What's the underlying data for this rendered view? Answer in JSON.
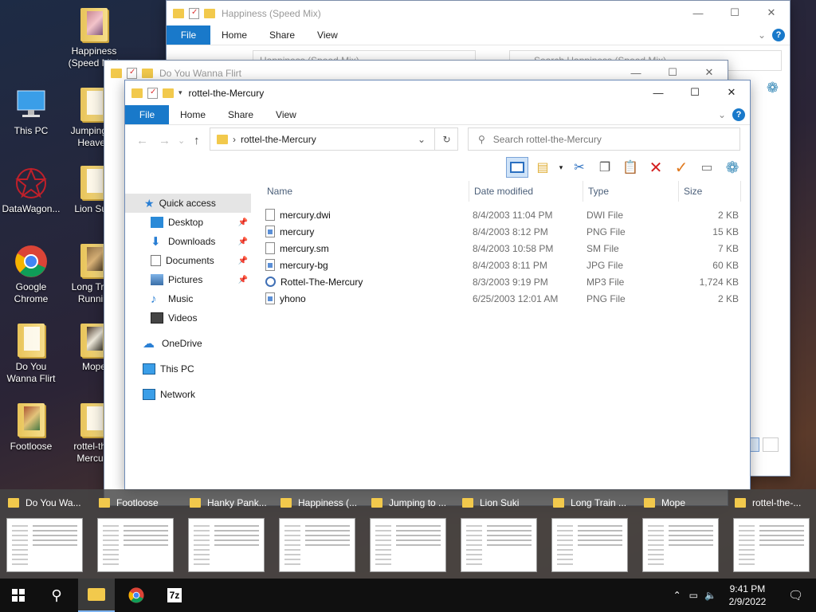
{
  "desktop": {
    "icons": [
      {
        "label": "Happiness (Speed Mix)",
        "kind": "folder-art"
      },
      {
        "label": "This PC",
        "kind": "pc"
      },
      {
        "label": "Jumping to Heaven",
        "kind": "folder"
      },
      {
        "label": "DataWagon...",
        "kind": "app"
      },
      {
        "label": "Lion Suki",
        "kind": "folder"
      },
      {
        "label": "Google Chrome",
        "kind": "chrome"
      },
      {
        "label": "Long Train Runnin'",
        "kind": "folder-art"
      },
      {
        "label": "Do You Wanna Flirt",
        "kind": "folder"
      },
      {
        "label": "Mope",
        "kind": "folder-art"
      },
      {
        "label": "Footloose",
        "kind": "folder-art"
      },
      {
        "label": "rottel-the-Mercury",
        "kind": "folder"
      }
    ]
  },
  "windows": {
    "back1": {
      "title": "Happiness (Speed Mix)",
      "ribbon": {
        "file": "File",
        "home": "Home",
        "share": "Share",
        "view": "View"
      },
      "address": "Happiness (Speed Mix)",
      "search": "Search Happiness (Speed Mix)"
    },
    "back2": {
      "title": "Do You Wanna Flirt"
    },
    "main": {
      "title": "rottel-the-Mercury",
      "ribbon": {
        "file": "File",
        "home": "Home",
        "share": "Share",
        "view": "View"
      },
      "address": "rottel-the-Mercury",
      "search_placeholder": "Search rottel-the-Mercury",
      "nav": {
        "quick_access": "Quick access",
        "items": [
          "Desktop",
          "Downloads",
          "Documents",
          "Pictures",
          "Music",
          "Videos"
        ],
        "onedrive": "OneDrive",
        "thispc": "This PC",
        "network": "Network"
      },
      "columns": {
        "name": "Name",
        "date": "Date modified",
        "type": "Type",
        "size": "Size"
      },
      "files": [
        {
          "name": "mercury.dwi",
          "date": "8/4/2003 11:04 PM",
          "type": "DWI File",
          "size": "2 KB",
          "icon": "file-icon"
        },
        {
          "name": "mercury",
          "date": "8/4/2003 8:12 PM",
          "type": "PNG File",
          "size": "15 KB",
          "icon": "image-file-icon"
        },
        {
          "name": "mercury.sm",
          "date": "8/4/2003 10:58 PM",
          "type": "SM File",
          "size": "7 KB",
          "icon": "file-icon"
        },
        {
          "name": "mercury-bg",
          "date": "8/4/2003 8:11 PM",
          "type": "JPG File",
          "size": "60 KB",
          "icon": "image-file-icon"
        },
        {
          "name": "Rottel-The-Mercury",
          "date": "8/3/2003 9:19 PM",
          "type": "MP3 File",
          "size": "1,724 KB",
          "icon": "audio-file-icon"
        },
        {
          "name": "yhono",
          "date": "6/25/2003 12:01 AM",
          "type": "PNG File",
          "size": "2 KB",
          "icon": "image-file-icon"
        }
      ]
    }
  },
  "thumbnails": [
    "Do You Wa...",
    "Footloose",
    "Hanky Pank...",
    "Happiness (...",
    "Jumping to ...",
    "Lion Suki",
    "Long Train ...",
    "Mope",
    "rottel-the-..."
  ],
  "taskbar": {
    "time": "9:41 PM",
    "date": "2/9/2022",
    "sevenzip": "7z"
  },
  "colors": {
    "accent": "#1979ca",
    "taskbar": "#101010"
  }
}
